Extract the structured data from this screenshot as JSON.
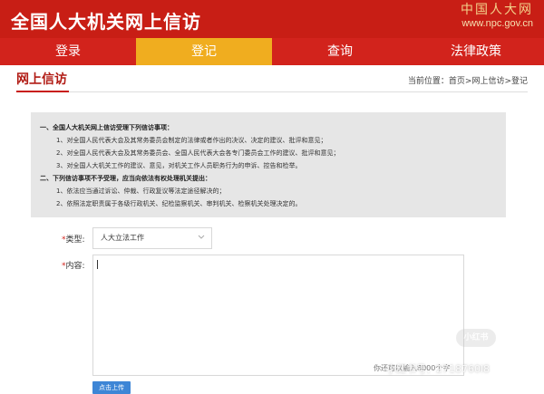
{
  "header": {
    "site_title": "全国人大机关网上信访",
    "logo_cn": "中国人大网",
    "logo_url": "www.npc.gov.cn",
    "bg_color": "#c81e15"
  },
  "nav": {
    "items": [
      {
        "label": "登录",
        "active": false
      },
      {
        "label": "登记",
        "active": true
      },
      {
        "label": "查询",
        "active": false
      },
      {
        "label": "法律政策",
        "active": false
      }
    ],
    "active_color": "#f0ad1f"
  },
  "subhead": {
    "title": "网上信访",
    "breadcrumb": "当前位置：首页>网上信访>登记"
  },
  "notice": {
    "lines": [
      {
        "text": "一、全国人大机关网上信访受理下列信访事项：",
        "head": true
      },
      {
        "text": "1、对全国人民代表大会及其常务委员会制定的法律或者作出的决议、决定的建议、批评和意见；",
        "head": false
      },
      {
        "text": "2、对全国人民代表大会及其常务委员会、全国人民代表大会各专门委员会工作的建议、批评和意见；",
        "head": false
      },
      {
        "text": "3、对全国人大机关工作的建议、意见，对机关工作人员职务行为的申诉、控告和检举。",
        "head": false
      },
      {
        "text": "二、下列信访事项不予受理，应当向依法有权处理机关提出：",
        "head": true
      },
      {
        "text": "1、依法应当通过诉讼、仲裁、行政复议等法定途径解决的；",
        "head": false
      },
      {
        "text": "2、依照法定职责属于各级行政机关、纪检监察机关、审判机关、检察机关处理决定的。",
        "head": false
      }
    ]
  },
  "form": {
    "type_label": "类型:",
    "type_value": "人大立法工作",
    "content_label": "内容:",
    "required_mark": "*",
    "counter_text": "你还可以输入8000个字",
    "upload_label": "点击上传"
  },
  "watermark": {
    "badge": "小红书",
    "text": "小红书号：2718760l8"
  }
}
